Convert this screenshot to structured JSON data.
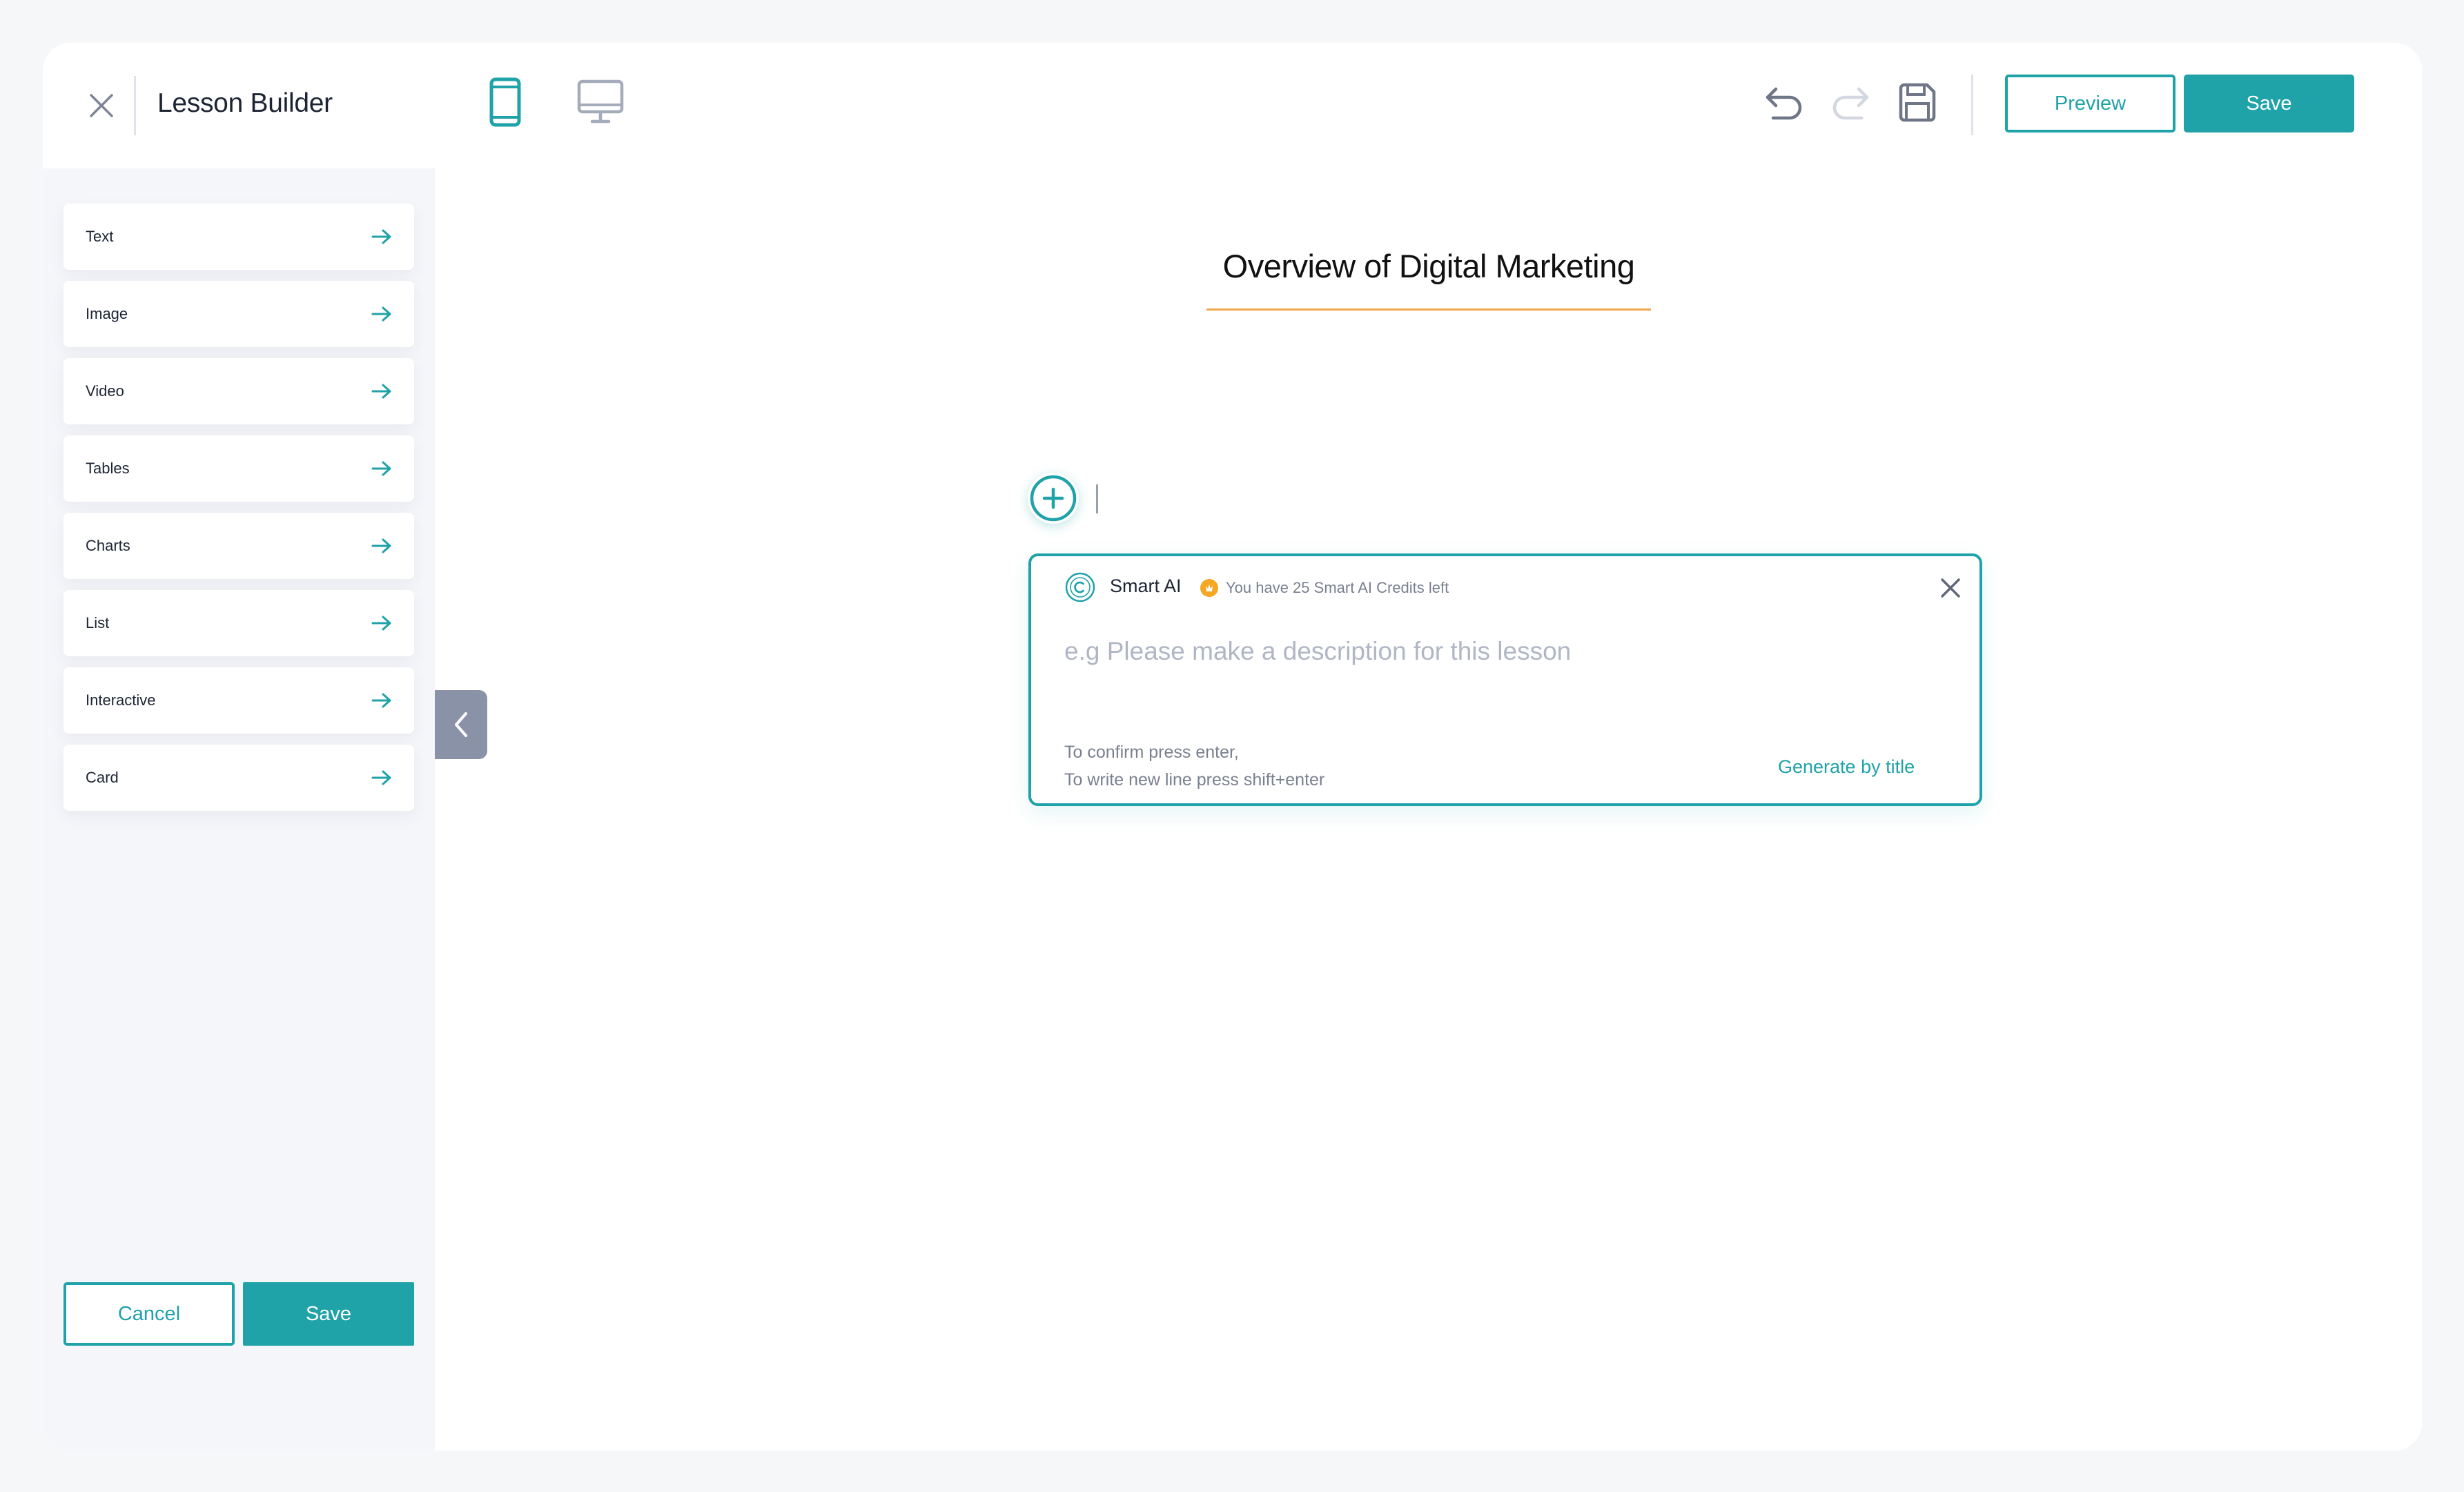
{
  "header": {
    "title": "Lesson Builder",
    "preview_label": "Preview",
    "save_label": "Save"
  },
  "sidebar": {
    "items": [
      {
        "label": "Text"
      },
      {
        "label": "Image"
      },
      {
        "label": "Video"
      },
      {
        "label": "Tables"
      },
      {
        "label": "Charts"
      },
      {
        "label": "List"
      },
      {
        "label": "Interactive"
      },
      {
        "label": "Card"
      }
    ],
    "cancel_label": "Cancel",
    "save_label": "Save"
  },
  "lesson": {
    "title": "Overview of Digital Marketing"
  },
  "ai_panel": {
    "name": "Smart AI",
    "credits_text": "You have 25 Smart AI Credits left",
    "input_value": "",
    "input_placeholder": "e.g Please make a description for this lesson",
    "hint_line1": "To confirm press enter,",
    "hint_line2": "To write new line press shift+enter",
    "generate_label": "Generate by title"
  },
  "colors": {
    "accent": "#1fa2a8",
    "title_underline": "#f2a54b",
    "credit_badge": "#f5a623",
    "handle": "#8a92a8"
  },
  "icons": {
    "close": "close-icon",
    "mobile_view": "mobile-view-icon",
    "desktop_view": "desktop-view-icon",
    "undo": "undo-icon",
    "redo": "redo-icon",
    "save_draft": "floppy-disk-icon",
    "item_arrow": "arrow-right-icon",
    "collapse": "chevron-left-icon",
    "add_block": "plus-circle-icon",
    "ai_logo": "smart-ai-logo-icon",
    "credit": "credit-coin-icon"
  }
}
